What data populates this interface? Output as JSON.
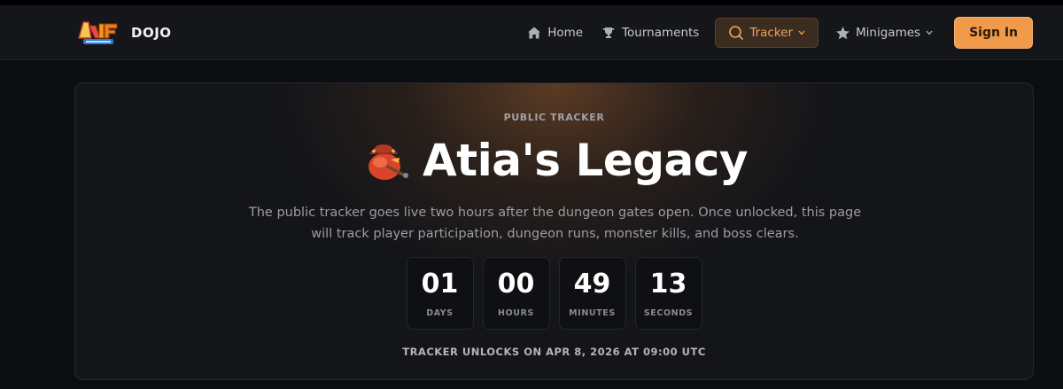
{
  "header": {
    "brand": "DOJO",
    "logo_text": "Axie Infinity",
    "nav": [
      {
        "label": "Home",
        "icon": "home-icon"
      },
      {
        "label": "Tournaments",
        "icon": "trophy-icon"
      },
      {
        "label": "Tracker",
        "icon": "search-icon",
        "active": true
      },
      {
        "label": "Minigames",
        "icon": "star-icon"
      }
    ],
    "signin_label": "Sign In"
  },
  "hero": {
    "eyebrow": "PUBLIC TRACKER",
    "title": "Atia's Legacy",
    "description": "The public tracker goes live two hours after the dungeon gates open. Once unlocked, this page will track player participation, dungeon runs, monster kills, and boss clears.",
    "countdown": [
      {
        "value": "01",
        "label": "DAYS"
      },
      {
        "value": "00",
        "label": "HOURS"
      },
      {
        "value": "49",
        "label": "MINUTES"
      },
      {
        "value": "13",
        "label": "SECONDS"
      }
    ],
    "unlock_text": "TRACKER UNLOCKS ON APR 8, 2026 AT 09:00 UTC"
  },
  "colors": {
    "accent": "#f09a4a",
    "active_nav_bg": "#3a2c1f",
    "active_nav_text": "#f0a55a",
    "background": "#0c0d10"
  }
}
